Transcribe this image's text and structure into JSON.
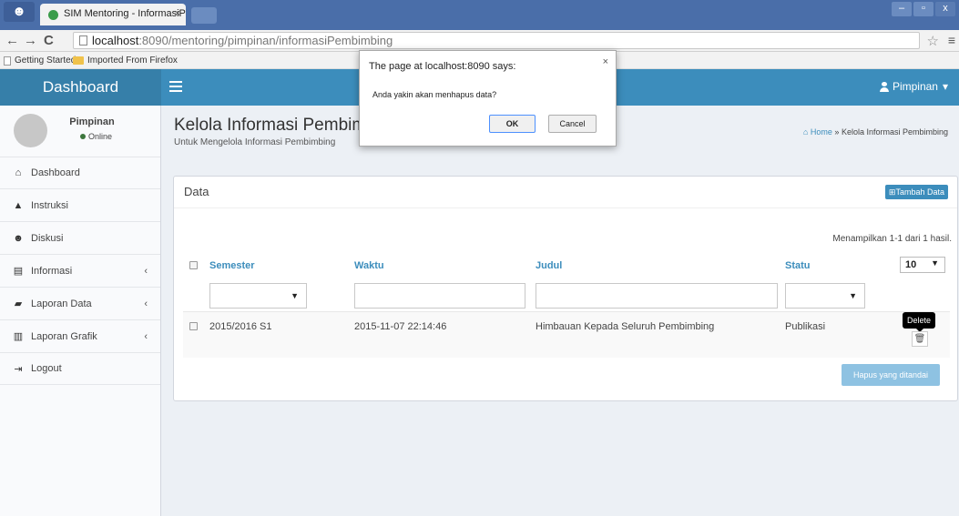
{
  "browser": {
    "tab_title": "SIM Mentoring - InformasiPe",
    "tab_close": "×",
    "url_host": "localhost",
    "url_rest": ":8090/mentoring/pimpinan/informasiPembimbing",
    "bookmarks": [
      "Getting Started",
      "Imported From Firefox"
    ],
    "window_controls": [
      "‒",
      "▫",
      "x"
    ]
  },
  "header": {
    "logo": "Dashboard",
    "user_label": "Pimpinan",
    "user_caret": "▾"
  },
  "sidebar": {
    "user_name": "Pimpinan",
    "user_status": "Online",
    "items": [
      {
        "label": "Dashboard",
        "icon": "home-icon",
        "glyph": "⌂",
        "chevron": ""
      },
      {
        "label": "Instruksi",
        "icon": "warning-icon",
        "glyph": "▲",
        "chevron": ""
      },
      {
        "label": "Diskusi",
        "icon": "users-icon",
        "glyph": "☻",
        "chevron": ""
      },
      {
        "label": "Informasi",
        "icon": "file-icon",
        "glyph": "▤",
        "chevron": "‹"
      },
      {
        "label": "Laporan Data",
        "icon": "book-icon",
        "glyph": "▰",
        "chevron": "‹"
      },
      {
        "label": "Laporan Grafik",
        "icon": "bar-chart-icon",
        "glyph": "▥",
        "chevron": "‹"
      },
      {
        "label": "Logout",
        "icon": "logout-icon",
        "glyph": "⇥",
        "chevron": ""
      }
    ]
  },
  "page": {
    "title": "Kelola Informasi Pembim",
    "subtitle": "Untuk Mengelola Informasi Pembimbing",
    "breadcrumb_home": "Home",
    "breadcrumb_sep": "»",
    "breadcrumb_current": "Kelola Informasi Pembimbing"
  },
  "box": {
    "title": "Data",
    "add_button": "Tambah Data",
    "summary": "Menampilkan 1-1 dari 1 hasil.",
    "per_page": "10",
    "columns": [
      "Semester",
      "Waktu",
      "Judul",
      "Statu"
    ],
    "rows": [
      {
        "semester": "2015/2016 S1",
        "waktu": "2015-11-07 22:14:46",
        "judul": "Himbauan Kepada Seluruh Pembimbing",
        "status": "Publikasi"
      }
    ],
    "tooltip": "Delete",
    "delete_marked_button": "Hapus yang ditandai"
  },
  "dialog": {
    "title": "The page at localhost:8090 says:",
    "message": "Anda yakin akan menhapus data?",
    "ok": "OK",
    "cancel": "Cancel"
  },
  "colors": {
    "header": "#3c8dbc",
    "logo_bg": "#367fa9",
    "link": "#3c8dbc",
    "online": "#3c763d"
  }
}
